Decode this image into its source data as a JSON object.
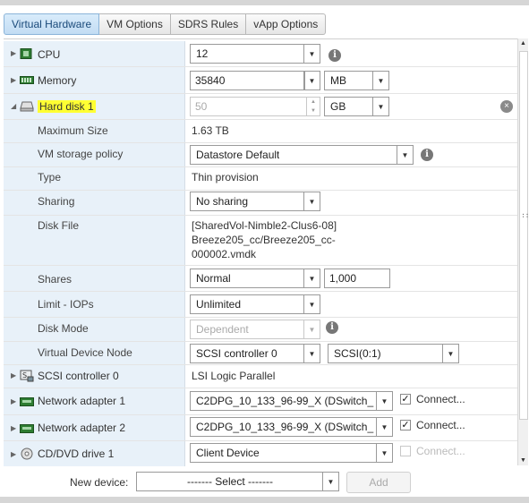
{
  "tabs": [
    {
      "label": "Virtual Hardware"
    },
    {
      "label": "VM Options"
    },
    {
      "label": "SDRS Rules"
    },
    {
      "label": "vApp Options"
    }
  ],
  "cpu": {
    "label": "CPU",
    "value": "12"
  },
  "memory": {
    "label": "Memory",
    "value": "35840",
    "unit": "MB"
  },
  "hard_disk": {
    "label": "Hard disk 1",
    "size_value": "50",
    "size_unit": "GB",
    "maximum_size_label": "Maximum Size",
    "maximum_size_value": "1.63 TB",
    "storage_policy_label": "VM storage policy",
    "storage_policy_value": "Datastore Default",
    "type_label": "Type",
    "type_value": "Thin provision",
    "sharing_label": "Sharing",
    "sharing_value": "No sharing",
    "disk_file_label": "Disk File",
    "disk_file_lines": [
      "[SharedVol-Nimble2-Clus6-08]",
      "Breeze205_cc/Breeze205_cc-",
      "000002.vmdk"
    ],
    "shares_label": "Shares",
    "shares_level": "Normal",
    "shares_value": "1,000",
    "limit_label": "Limit - IOPs",
    "limit_value": "Unlimited",
    "disk_mode_label": "Disk Mode",
    "disk_mode_value": "Dependent",
    "vdn_label": "Virtual Device Node",
    "vdn_controller": "SCSI controller 0",
    "vdn_slot": "SCSI(0:1)"
  },
  "scsi": {
    "label": "SCSI controller 0",
    "value": "LSI Logic Parallel"
  },
  "net1": {
    "label": "Network adapter 1",
    "value": "C2DPG_10_133_96-99_X (DSwitch_",
    "connect_label": "Connect...",
    "connected": true
  },
  "net2": {
    "label": "Network adapter 2",
    "value": "C2DPG_10_133_96-99_X (DSwitch_",
    "connect_label": "Connect...",
    "connected": true
  },
  "cdrom": {
    "label": "CD/DVD drive 1",
    "value": "Client Device",
    "connect_label": "Connect...",
    "connected": false
  },
  "footer": {
    "new_device_label": "New device:",
    "select_placeholder": "------- Select -------",
    "add_label": "Add"
  },
  "glyphs": {
    "check": "✓",
    "info": "i",
    "close": "×",
    "arrow_down": "▼",
    "collapsed": "▶",
    "expanded": "◢",
    "spin_up": "▲",
    "spin_down": "▼",
    "grip": "::"
  }
}
